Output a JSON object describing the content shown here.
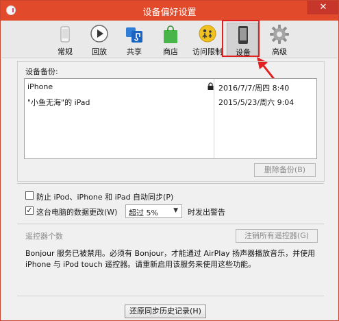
{
  "window": {
    "title": "设备偏好设置",
    "close_glyph": "✕"
  },
  "toolbar": {
    "items": [
      {
        "label": "常规",
        "icon": "phone-general-icon"
      },
      {
        "label": "回放",
        "icon": "play-icon"
      },
      {
        "label": "共享",
        "icon": "music-share-icon"
      },
      {
        "label": "商店",
        "icon": "store-bag-icon"
      },
      {
        "label": "访问限制",
        "icon": "parental-restrictions-icon"
      },
      {
        "label": "设备",
        "icon": "device-icon",
        "selected": true
      },
      {
        "label": "高级",
        "icon": "gear-icon"
      }
    ]
  },
  "backups": {
    "section_label": "设备备份:",
    "rows": [
      {
        "name": "iPhone",
        "locked": true,
        "date": "2016/7/7/周四 8:40"
      },
      {
        "name": "\"小鱼无海\"的 iPad",
        "locked": false,
        "date": "2015/5/23/周六 9:04"
      }
    ],
    "delete_button": "删除备份(B)"
  },
  "options": {
    "prevent_sync_label": "防止 iPod、iPhone 和 iPad 自动同步(P)",
    "prevent_sync_checked": false,
    "warn_label_prefix": "这台电脑的数据更改(W)",
    "warn_checked": true,
    "warn_select_value": "超过 5%",
    "warn_label_suffix": "时发出警告"
  },
  "remotes": {
    "count_label": "遥控器个数",
    "forget_button": "注销所有遥控器(G)",
    "description": "Bonjour 服务已被禁用。必须有 Bonjour，才能通过 AirPlay 扬声器播放音乐，并使用 iPhone 与 iPod touch 遥控器。请重新启用该服务来使用这些功能。"
  },
  "footer": {
    "reset_button": "还原同步历史记录(H)"
  },
  "colors": {
    "titlebar": "#e14b2c",
    "annotation": "#e02020"
  }
}
